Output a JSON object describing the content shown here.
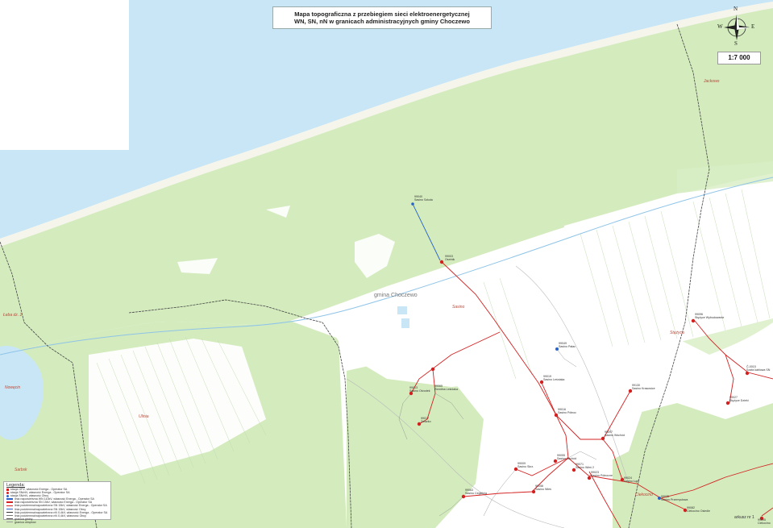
{
  "map": {
    "title_line1": "Mapa topograficzna z przebiegiem sieci elektroenergetycznej",
    "title_line2": "WN, SN, nN w granicach administracyjnych gminy Choczewo",
    "scale": "1:7 000",
    "compass": {
      "n": "N",
      "s": "S",
      "e": "E",
      "w": "W"
    },
    "gmina_label": "gmina Choczewo",
    "sheet_label": "arkusz nr 1",
    "colors": {
      "sea": "#c8e6f5",
      "beach": "#f7f7ef",
      "forest": "#d3ebbd",
      "field": "#ffffff",
      "mv_line": "#d42020",
      "hv_line": "#2a63c8",
      "boundary": "#555555"
    }
  },
  "places": [
    {
      "name": "Jackowo"
    },
    {
      "name": "Łeba dz. 2"
    },
    {
      "name": "Nowęcin"
    },
    {
      "name": "Sarbsk"
    },
    {
      "name": "Ulinia"
    },
    {
      "name": "Sasino"
    },
    {
      "name": "Stężyca"
    },
    {
      "name": "Ciekocino"
    }
  ],
  "stations": [
    {
      "code": "99040",
      "name": "Sasino Szkoła"
    },
    {
      "code": "99003",
      "name": "Osetnik"
    },
    {
      "code": "99096",
      "name": "Stężyce Wybudowanie"
    },
    {
      "code": "Č-0015",
      "name": "Szafa kablowa SN"
    },
    {
      "code": "99049",
      "name": "Sasino Pałac"
    },
    {
      "code": "99019",
      "name": "Sasino Leśniaka"
    },
    {
      "code": "99130",
      "name": "Sasino Krasowice"
    },
    {
      "code": "99027",
      "name": "Stężyce Dzieki"
    },
    {
      "code": "99065",
      "name": "Ziemiłna Leśniaka"
    },
    {
      "code": "99013",
      "name": "Sasino Ośrodek"
    },
    {
      "code": "99016",
      "name": "Sasino Północ"
    },
    {
      "code": "99017",
      "name": "Żelazko"
    },
    {
      "code": "99097",
      "name": "Sasino Wschód"
    },
    {
      "code": "99055",
      "name": "Sasino Zachód"
    },
    {
      "code": "99009",
      "name": "Sasino Skrz."
    },
    {
      "code": "99056",
      "name": "Sasino Wieś"
    },
    {
      "code": "99023",
      "name": "Sasino Północne"
    },
    {
      "code": "99024",
      "name": "Sasino Łąki"
    },
    {
      "code": "99063",
      "name": "Sasino Cegielnia"
    },
    {
      "code": "99071",
      "name": "Sasino Wieś 2"
    },
    {
      "code": "99035",
      "name": "Sasino Przemysłowa"
    },
    {
      "code": "99082",
      "name": "Ciekocino Osiedle"
    },
    {
      "code": "99095",
      "name": "Ciekocino"
    }
  ],
  "legend": {
    "title": "Legenda:",
    "items": [
      {
        "text": "stacja GPZ, własność Energa - Operator SA",
        "color": "#d42020"
      },
      {
        "text": "stacja SN/nN, własność Energa - Operator SA",
        "color": "#d42020"
      },
      {
        "text": "stacja SN/nN, własność Obcy",
        "color": "#2a63c8"
      },
      {
        "text": "linia napowietrzna WN 110kV, własność Energa - Operator SA",
        "color": "#2a63c8"
      },
      {
        "text": "linia napowietrzna SN 15kV, własność Energa - Operator SA",
        "color": "#d42020"
      },
      {
        "text": "linia podziemna/napowietrzna SN 15kV, własność Energa - Operator SA",
        "color": "#d42020"
      },
      {
        "text": "linia podziemna/napowietrzna SN 15kV, własność Obcy",
        "color": "#2a63c8"
      },
      {
        "text": "linia podziemna/napowietrzna nN 0,4kV, własność Energa - Operator SA",
        "color": "#333333"
      },
      {
        "text": "linia podziemna/napowietrzna nN 0,4kV, własność Obcy",
        "color": "#777777"
      },
      {
        "text": "granica gminy",
        "color": "#555555"
      },
      {
        "text": "granica obrębów",
        "color": "#999999"
      }
    ]
  }
}
